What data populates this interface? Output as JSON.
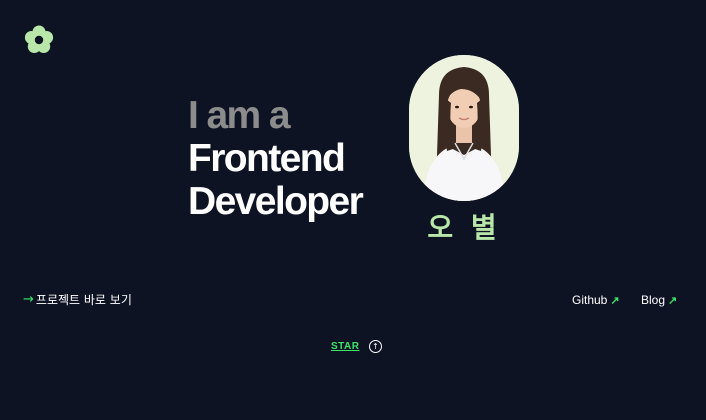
{
  "logo": {
    "icon": "flower-icon",
    "color": "#b8e7a9"
  },
  "hero": {
    "line1": "I am a",
    "line2": "Frontend",
    "line3": "Developer"
  },
  "profile": {
    "name": "오 별",
    "photo_icon": "profile-photo"
  },
  "links": {
    "projects_arrow": "→",
    "projects_label": "프로젝트 바로 보기",
    "github_label": "Github",
    "blog_label": "Blog",
    "external_arrow": "↗"
  },
  "footer": {
    "star_label": "STAR",
    "up_icon": "arrow-up-circle-icon"
  },
  "colors": {
    "background": "#0e1323",
    "accent_green": "#39e66b",
    "name_green": "#b8e7a9",
    "muted_text": "#8c8c8c"
  }
}
